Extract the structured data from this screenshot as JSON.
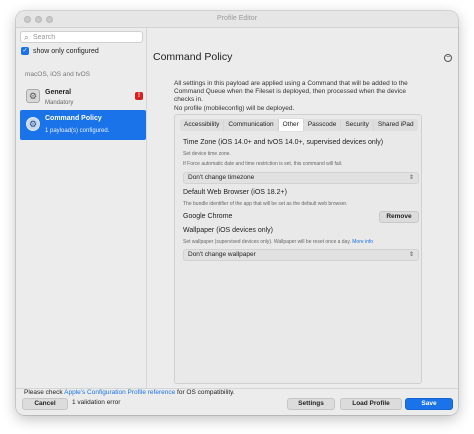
{
  "window": {
    "title": "Profile Editor"
  },
  "sidebar": {
    "search_placeholder": "Search",
    "search_icon": "magnifier",
    "show_only_configured": "show only configured",
    "section": "macOS, iOS and tvOS",
    "items": [
      {
        "title": "General",
        "subtitle": "Mandatory",
        "badge": "!",
        "icon": "gear-box"
      },
      {
        "title": "Command Policy",
        "subtitle": "1 payload(s) configured.",
        "icon": "gear-circle"
      }
    ]
  },
  "main": {
    "title": "Command Policy",
    "collapse_symbol": "−",
    "intro_line1": "All settings in this payload are applied using a Command that will be added to the Command Queue when the Fileset is deployed, then processed when the device checks in.",
    "intro_line2": "No profile (mobileconfig) will be deployed.",
    "tabs": [
      "Accessibility",
      "Communication",
      "Other",
      "Passcode",
      "Security",
      "Shared iPad"
    ],
    "active_tab": "Other",
    "fields": {
      "timezone_label": "Time Zone (iOS 14.0+ and tvOS 14.0+, supervised devices only)",
      "timezone_desc1": "Set device time zone.",
      "timezone_desc2": "If Force automatic date and time restriction is set, this command will fail.",
      "timezone_value": "Don't change timezone",
      "browser_label": "Default Web Browser (iOS 18.2+)",
      "browser_desc": "The bundle identifier of the app that will be set as the default web browser.",
      "browser_value": "Google Chrome",
      "remove_label": "Remove",
      "wallpaper_label": "Wallpaper (iOS devices only)",
      "wallpaper_desc": "Set wallpaper (supervised devices only). Wallpaper will be reset once a day.",
      "wallpaper_more": "More info",
      "wallpaper_value": "Don't change wallpaper",
      "chevron": "⌃⌄"
    }
  },
  "footer": {
    "note_prefix": "Please check",
    "note_link": "Apple's Configuration Profile reference",
    "note_suffix": "for OS compatibility.",
    "cancel": "Cancel",
    "validation": "1 validation error",
    "settings": "Settings",
    "load_profile": "Load Profile",
    "save": "Save"
  },
  "colors": {
    "accent": "#1a73e8",
    "error": "#d81e1e"
  }
}
